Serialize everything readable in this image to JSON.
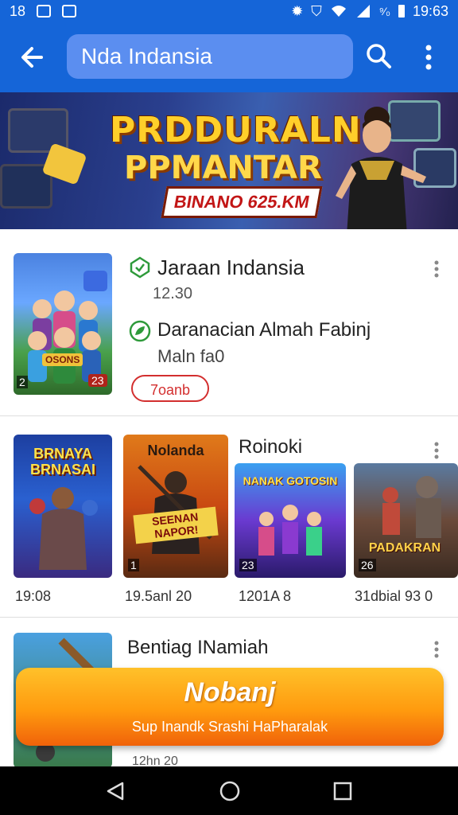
{
  "status_bar": {
    "left_number": "18",
    "time": "19:63",
    "signal_text": "⁹⁄₀"
  },
  "app_bar": {
    "search_text": "Nda Indansia"
  },
  "banner": {
    "title_line1": "PRDDURALN",
    "title_line2": "PPMANTAR",
    "subtitle": "BINANO 625.KM"
  },
  "card1": {
    "title": "Jaraan Indansia",
    "count": "12.30",
    "subtitle": "Daranacian Almah Fabinj",
    "meta": "Maln fa0",
    "button_label": "7oanb",
    "thumb_label": "OSONS",
    "thumb_corner_left": "2",
    "thumb_corner_right": "23"
  },
  "card2": {
    "title": "Roinoki",
    "items": [
      {
        "label": "BRNAYA BRNASAI",
        "caption": "19:08",
        "corner": ""
      },
      {
        "label": "Nolanda",
        "sub": "SEENAN NAPOR!",
        "caption": "19.5anl 20",
        "corner": "1"
      },
      {
        "label": "NANAK GOTOSIN",
        "caption": "1201A 8",
        "corner": "23"
      },
      {
        "label": "PADAKRAN",
        "caption": "31dbial 93 0",
        "corner": "26"
      }
    ]
  },
  "card3": {
    "title": "Bentiag INamiah",
    "caption": "12hn 20"
  },
  "cta": {
    "title": "Nobanj",
    "subtitle": "Sup Inandk Srashi HaPharalak"
  },
  "colors": {
    "primary": "#1565d8",
    "accent_red": "#d32f2f",
    "cta_orange": "#ff9a0e"
  }
}
